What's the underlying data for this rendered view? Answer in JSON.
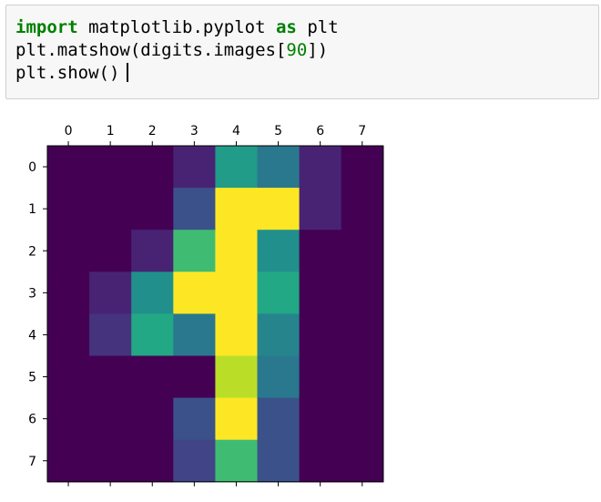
{
  "colors": {
    "keyword": "#008000",
    "number": "#008000",
    "text": "#000000",
    "cell_background": "#f7f7f7",
    "cell_border": "#cfcfcf",
    "caret": "#000000"
  },
  "code_cell": {
    "line1": {
      "keyword_import": "import",
      "module": " matplotlib.pyplot ",
      "keyword_as": "as",
      "alias": " plt"
    },
    "line2": {
      "before": "plt.matshow(digits.images[",
      "number": "90",
      "after": "])"
    },
    "line3": {
      "text": "plt.show()"
    }
  },
  "chart_data": {
    "type": "heatmap",
    "title": "",
    "xlabel": "",
    "ylabel": "",
    "colormap": "viridis",
    "vmin": 0,
    "vmax": 16,
    "x_ticks": [
      "0",
      "1",
      "2",
      "3",
      "4",
      "5",
      "6",
      "7"
    ],
    "y_ticks": [
      "0",
      "1",
      "2",
      "3",
      "4",
      "5",
      "6",
      "7"
    ],
    "x_tick_position": "top",
    "grid": false,
    "matrix": [
      [
        0,
        0,
        0,
        2,
        11,
        8,
        2,
        0
      ],
      [
        0,
        0,
        0,
        5,
        16,
        16,
        2,
        0
      ],
      [
        0,
        0,
        2,
        13,
        16,
        10,
        0,
        0
      ],
      [
        0,
        2,
        10,
        16,
        16,
        12,
        0,
        0
      ],
      [
        0,
        3,
        12,
        8,
        16,
        9,
        0,
        0
      ],
      [
        0,
        0,
        0,
        0,
        15,
        8,
        0,
        0
      ],
      [
        0,
        0,
        0,
        5,
        16,
        5,
        0,
        0
      ],
      [
        0,
        0,
        0,
        4,
        13,
        5,
        0,
        0
      ]
    ]
  }
}
